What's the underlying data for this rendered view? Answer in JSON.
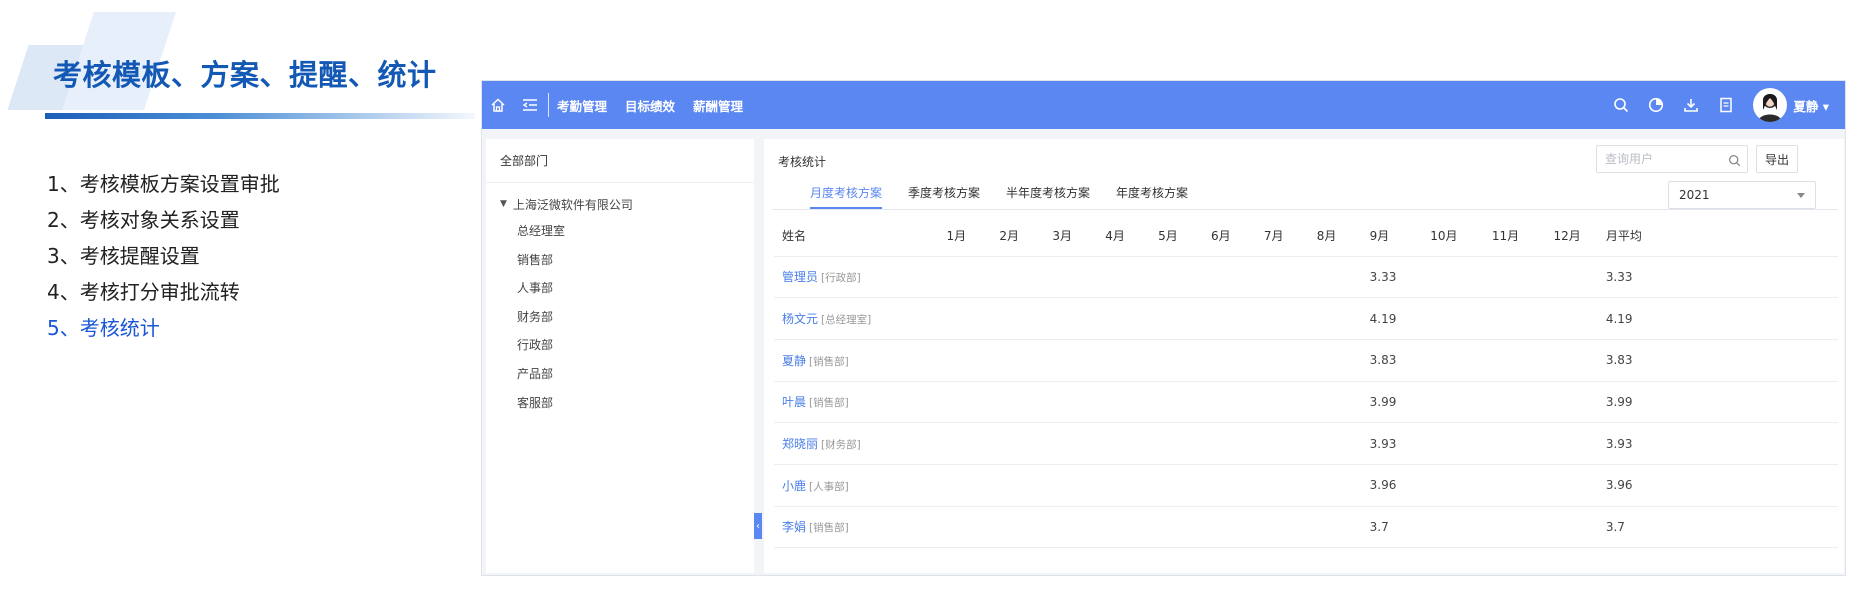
{
  "slide": {
    "title": "考核模板、方案、提醒、统计",
    "menu": [
      {
        "label": "1、考核模板方案设置审批",
        "active": false
      },
      {
        "label": "2、考核对象关系设置",
        "active": false
      },
      {
        "label": "3、考核提醒设置",
        "active": false
      },
      {
        "label": "4、考核打分审批流转",
        "active": false
      },
      {
        "label": "5、考核统计",
        "active": true
      }
    ]
  },
  "topbar": {
    "nav": [
      "考勤管理",
      "目标绩效",
      "薪酬管理"
    ],
    "user_name": "夏静",
    "colors": {
      "bar": "#5b87f2"
    }
  },
  "sidebar": {
    "header": "全部部门",
    "root": "上海泛微软件有限公司",
    "departments": [
      "总经理室",
      "销售部",
      "人事部",
      "财务部",
      "行政部",
      "产品部",
      "客服部"
    ]
  },
  "main": {
    "title": "考核统计",
    "search_placeholder": "查询用户",
    "export_label": "导出",
    "tabs": [
      "月度考核方案",
      "季度考核方案",
      "半年度考核方案",
      "年度考核方案"
    ],
    "year": "2021",
    "columns": [
      "姓名",
      "1月",
      "2月",
      "3月",
      "4月",
      "5月",
      "6月",
      "7月",
      "8月",
      "9月",
      "10月",
      "11月",
      "12月",
      "月平均"
    ],
    "rows": [
      {
        "name": "管理员",
        "dept": "[行政部]",
        "months": [
          "",
          "",
          "",
          "",
          "",
          "",
          "",
          "",
          "3.33",
          "",
          "",
          ""
        ],
        "avg": "3.33"
      },
      {
        "name": "杨文元",
        "dept": "[总经理室]",
        "months": [
          "",
          "",
          "",
          "",
          "",
          "",
          "",
          "",
          "4.19",
          "",
          "",
          ""
        ],
        "avg": "4.19"
      },
      {
        "name": "夏静",
        "dept": "[销售部]",
        "months": [
          "",
          "",
          "",
          "",
          "",
          "",
          "",
          "",
          "3.83",
          "",
          "",
          ""
        ],
        "avg": "3.83"
      },
      {
        "name": "叶晨",
        "dept": "[销售部]",
        "months": [
          "",
          "",
          "",
          "",
          "",
          "",
          "",
          "",
          "3.99",
          "",
          "",
          ""
        ],
        "avg": "3.99"
      },
      {
        "name": "郑晓丽",
        "dept": "[财务部]",
        "months": [
          "",
          "",
          "",
          "",
          "",
          "",
          "",
          "",
          "3.93",
          "",
          "",
          ""
        ],
        "avg": "3.93"
      },
      {
        "name": "小鹿",
        "dept": "[人事部]",
        "months": [
          "",
          "",
          "",
          "",
          "",
          "",
          "",
          "",
          "3.96",
          "",
          "",
          ""
        ],
        "avg": "3.96"
      },
      {
        "name": "李娟",
        "dept": "[销售部]",
        "months": [
          "",
          "",
          "",
          "",
          "",
          "",
          "",
          "",
          "3.7",
          "",
          "",
          ""
        ],
        "avg": "3.7"
      }
    ]
  }
}
